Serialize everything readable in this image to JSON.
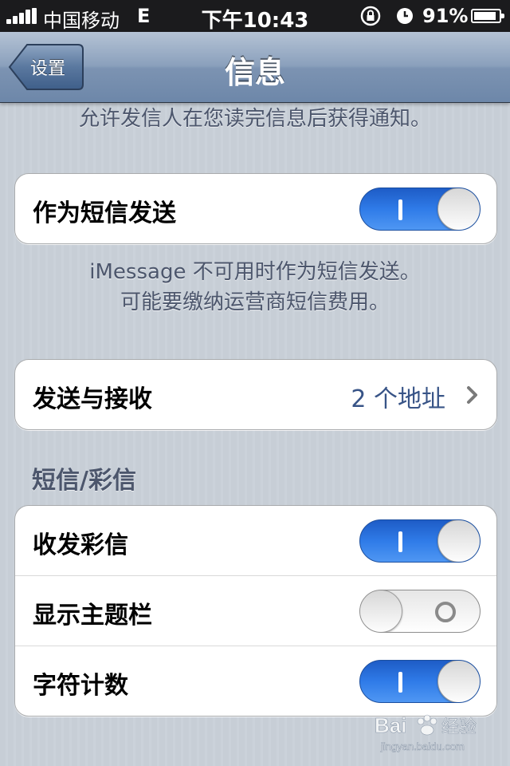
{
  "status_bar": {
    "carrier": "中国移动",
    "network": "E",
    "time": "下午10:43",
    "battery": "91%",
    "battery_level": 0.91
  },
  "nav_bar": {
    "back_label": "设置",
    "title": "信息"
  },
  "top_note": "允许发信人在您读完信息后获得通知。",
  "send_as_sms": {
    "label": "作为短信发送",
    "on": true
  },
  "send_as_sms_note": {
    "line1": "iMessage 不可用时作为短信发送。",
    "line2": "可能要缴纳运营商短信费用。"
  },
  "send_receive": {
    "label": "发送与接收",
    "value": "2 个地址"
  },
  "sms_mms_section": {
    "header": "短信/彩信",
    "rows": [
      {
        "label": "收发彩信",
        "on": true
      },
      {
        "label": "显示主题栏",
        "on": false
      },
      {
        "label": "字符计数",
        "on": true
      }
    ]
  },
  "watermark": {
    "brand": "Bai经验",
    "url": "jingyan.baidu.com"
  },
  "colors": {
    "switch_on": "#2f7be8",
    "value_text": "#385487",
    "section_text": "#4c566c"
  }
}
